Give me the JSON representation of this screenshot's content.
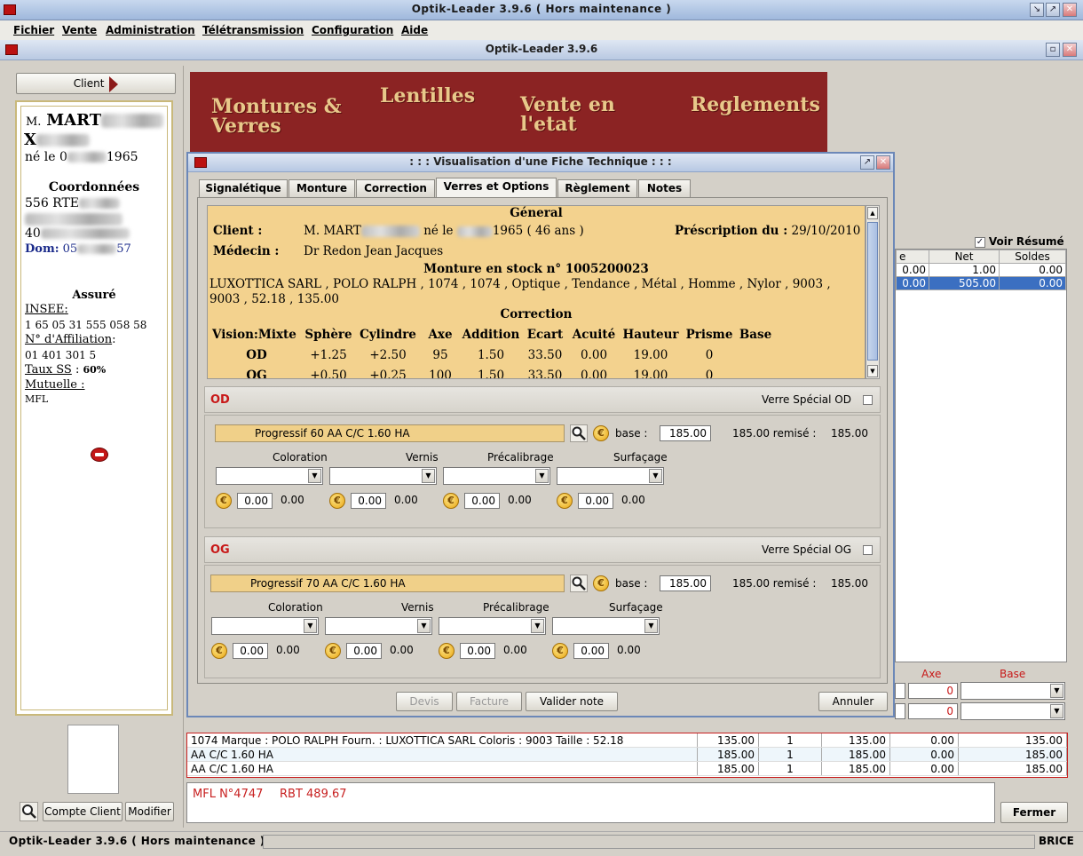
{
  "app": {
    "window_title": "Optik-Leader 3.9.6 ( Hors maintenance )",
    "inner_title": "Optik-Leader 3.9.6",
    "status_left": "Optik-Leader 3.9.6 ( Hors maintenance )",
    "status_user": "BRICE"
  },
  "menu": [
    "Fichier",
    "Vente",
    "Administration",
    "Télétransmission",
    "Configuration",
    "Aide"
  ],
  "client_panel": {
    "client_button": "Client",
    "civility": "M.",
    "name": "MART",
    "initial": "X",
    "birth_prefix": "né le 0",
    "birth_suffix": "1965",
    "coord_title": "Coordonnées",
    "address1": "556 RTE",
    "phone_prefix": "40",
    "dom_label": "Dom:",
    "dom_prefix": "05",
    "dom_suffix": "57",
    "assure_title": "Assuré",
    "insee_label": "INSEE",
    "insee_value": "1 65 05 31 555 058 58",
    "affiliation_label": "N° d'Affiliation",
    "affiliation_value": "01 401 301 5",
    "taux_label": "Taux SS",
    "taux_value": "60%",
    "mutuelle_label": "Mutuelle :",
    "mutuelle_value": "MFL",
    "compte_button": "Compte Client",
    "modifier_button": "Modifier"
  },
  "banner": {
    "montures": "Montures & Verres",
    "lentilles": "Lentilles",
    "vente": "Vente en l'etat",
    "reglements": "Reglements"
  },
  "right_panel": {
    "voir_resume": "Voir Résumé",
    "headers": [
      "e",
      "Net",
      "Soldes"
    ],
    "rows": [
      [
        "0.00",
        "1.00",
        "0.00"
      ],
      [
        "0.00",
        "505.00",
        "0.00"
      ]
    ],
    "axe_label": "Axe",
    "base_label": "Base",
    "axe_values": [
      "0",
      "0"
    ]
  },
  "dialog": {
    "title": ": : : Visualisation d'une Fiche Technique : : :",
    "tabs": [
      "Signalétique",
      "Monture",
      "Correction",
      "Verres et Options",
      "Règlement",
      "Notes"
    ],
    "active_tab": "Verres et Options",
    "general_title": "Géneral",
    "client_label": "Client :",
    "client_value_prefix": "M. MART",
    "client_value_mid": "né le",
    "client_value_suffix": "1965 ( 46 ans )",
    "prescription_label": "Préscription du :",
    "prescription_value": "29/10/2010",
    "medecin_label": "Médecin :",
    "medecin_value": "Dr Redon Jean Jacques",
    "monture_title": "Monture en stock n° 1005200023",
    "monture_desc": "LUXOTTICA SARL , POLO RALPH , 1074 , 1074 , Optique , Tendance , Métal , Homme , Nylor , 9003 , 9003 , 52.18 , 135.00",
    "correction_title": "Correction",
    "correction_headers": [
      "Vision:Mixte",
      "Sphère",
      "Cylindre",
      "Axe",
      "Addition",
      "Ecart",
      "Acuité",
      "Hauteur",
      "Prisme",
      "Base"
    ],
    "correction_rows": [
      [
        "OD",
        "+1.25",
        "+2.50",
        "95",
        "1.50",
        "33.50",
        "0.00",
        "19.00",
        "0",
        ""
      ],
      [
        "OG",
        "+0.50",
        "+0.25",
        "100",
        "1.50",
        "33.50",
        "0.00",
        "19.00",
        "0",
        ""
      ]
    ],
    "od": {
      "label": "OD",
      "special": "Verre Spécial OD",
      "lens": "Progressif    60    AA C/C 1.60 HA",
      "base_label": "base :",
      "base_value": "185.00",
      "remise_text": "185.00 remisé :",
      "remise_value": "185.00",
      "options": [
        "Coloration",
        "Vernis",
        "Précalibrage",
        "Surfaçage"
      ],
      "prices": [
        {
          "input": "0.00",
          "value": "0.00"
        },
        {
          "input": "0.00",
          "value": "0.00"
        },
        {
          "input": "0.00",
          "value": "0.00"
        },
        {
          "input": "0.00",
          "value": "0.00"
        }
      ]
    },
    "og": {
      "label": "OG",
      "special": "Verre Spécial OG",
      "lens": "Progressif    70    AA C/C 1.60 HA",
      "base_label": "base :",
      "base_value": "185.00",
      "remise_text": "185.00 remisé :",
      "remise_value": "185.00",
      "options": [
        "Coloration",
        "Vernis",
        "Précalibrage",
        "Surfaçage"
      ],
      "prices": [
        {
          "input": "0.00",
          "value": "0.00"
        },
        {
          "input": "0.00",
          "value": "0.00"
        },
        {
          "input": "0.00",
          "value": "0.00"
        },
        {
          "input": "0.00",
          "value": "0.00"
        }
      ]
    },
    "buttons": {
      "devis": "Devis",
      "facture": "Facture",
      "valider": "Valider note",
      "annuler": "Annuler"
    }
  },
  "bottom_table": [
    [
      "1074   Marque : POLO RALPH   Fourn. : LUXOTTICA SARL   Coloris : 9003   Taille : 52.18",
      "135.00",
      "1",
      "135.00",
      "0.00",
      "135.00"
    ],
    [
      "AA C/C 1.60 HA",
      "185.00",
      "1",
      "185.00",
      "0.00",
      "185.00"
    ],
    [
      "AA C/C 1.60 HA",
      "185.00",
      "1",
      "185.00",
      "0.00",
      "185.00"
    ]
  ],
  "notes": {
    "mutuelle": "MFL N°4747",
    "rbt": "RBT 489.67"
  },
  "fermer": "Fermer",
  "colors": {
    "accent_red": "#c81818",
    "banner": "#8b2323",
    "info_bg": "#f3d28e"
  }
}
